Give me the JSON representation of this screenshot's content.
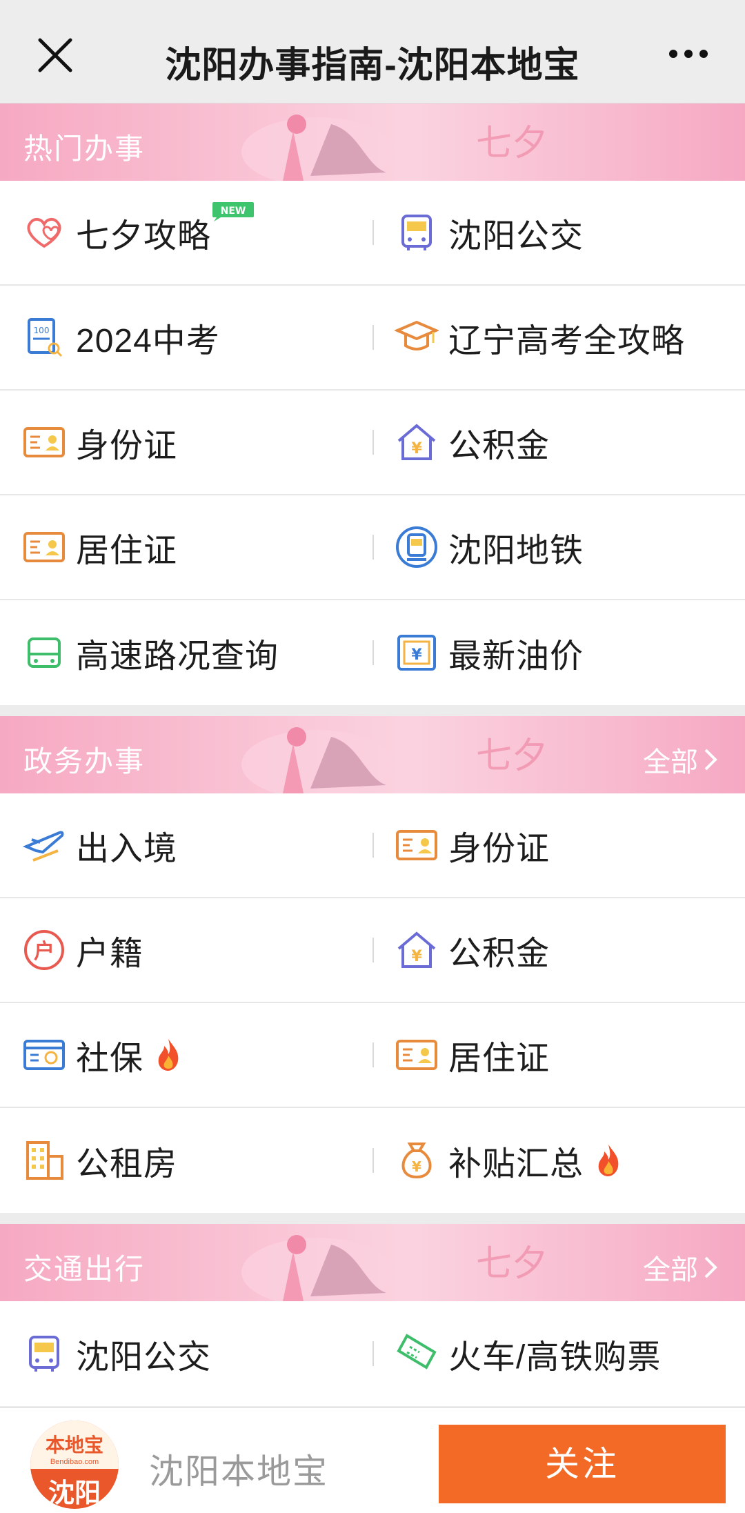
{
  "header": {
    "title": "沈阳办事指南-沈阳本地宝"
  },
  "sections": [
    {
      "title": "热门办事",
      "all": "",
      "rows": [
        [
          {
            "label": "七夕攻略",
            "icon": "heart-icon",
            "badge": "NEW"
          },
          {
            "label": "沈阳公交",
            "icon": "bus-icon"
          }
        ],
        [
          {
            "label": "2024中考",
            "icon": "exam-paper-icon"
          },
          {
            "label": "辽宁高考全攻略",
            "icon": "graduation-cap-icon"
          }
        ],
        [
          {
            "label": "身份证",
            "icon": "id-card-icon"
          },
          {
            "label": "公积金",
            "icon": "house-yen-icon"
          }
        ],
        [
          {
            "label": "居住证",
            "icon": "id-card-icon"
          },
          {
            "label": "沈阳地铁",
            "icon": "metro-icon"
          }
        ],
        [
          {
            "label": "高速路况查询",
            "icon": "bus-green-icon"
          },
          {
            "label": "最新油价",
            "icon": "yen-box-icon"
          }
        ]
      ]
    },
    {
      "title": "政务办事",
      "all": "全部",
      "rows": [
        [
          {
            "label": "出入境",
            "icon": "plane-icon"
          },
          {
            "label": "身份证",
            "icon": "id-card-icon"
          }
        ],
        [
          {
            "label": "户籍",
            "icon": "household-icon"
          },
          {
            "label": "公积金",
            "icon": "house-yen-icon"
          }
        ],
        [
          {
            "label": "社保",
            "icon": "social-card-icon",
            "hot": true
          },
          {
            "label": "居住证",
            "icon": "id-card-icon"
          }
        ],
        [
          {
            "label": "公租房",
            "icon": "building-icon"
          },
          {
            "label": "补贴汇总",
            "icon": "money-bag-icon",
            "hot": true
          }
        ]
      ]
    },
    {
      "title": "交通出行",
      "all": "全部",
      "rows": [
        [
          {
            "label": "沈阳公交",
            "icon": "bus-icon"
          },
          {
            "label": "火车/高铁购票",
            "icon": "ticket-icon"
          }
        ]
      ]
    }
  ],
  "footer": {
    "logo_text": "本地宝",
    "logo_sub": "Bendibao.com",
    "logo_city": "沈阳",
    "name": "沈阳本地宝",
    "follow": "关注"
  },
  "colors": {
    "accent": "#f26a25",
    "banner": "#f8bcd0"
  }
}
